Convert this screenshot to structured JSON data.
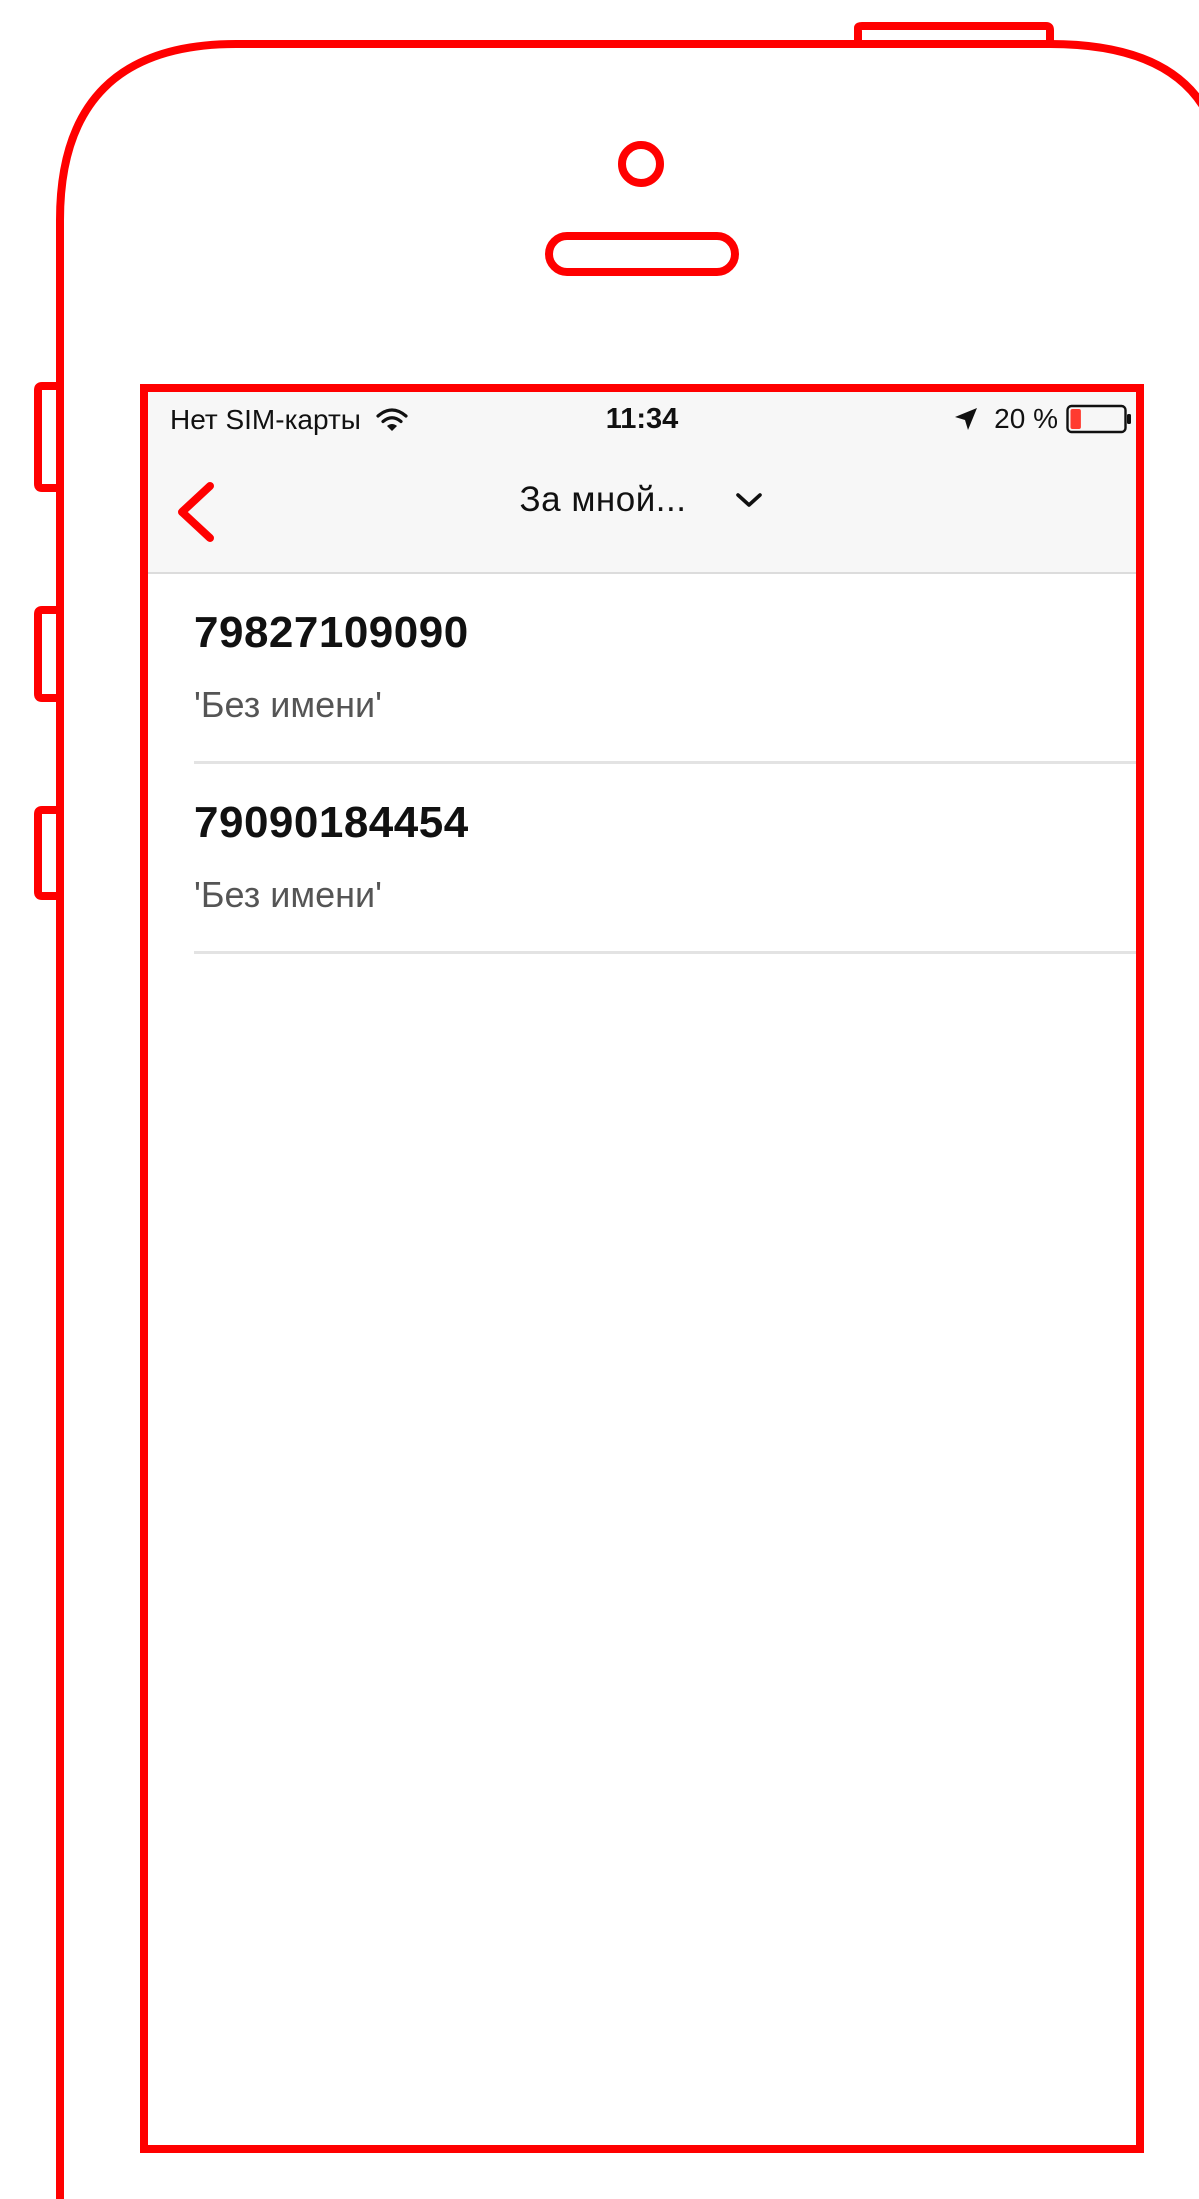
{
  "status_bar": {
    "carrier": "Нет SIM-карты",
    "time": "11:34",
    "battery": "20 %",
    "battery_level": 0.2,
    "icons": [
      "wifi-icon",
      "location-arrow-icon",
      "battery-icon"
    ]
  },
  "nav_bar": {
    "title": "За мной...",
    "back_icon": "chevron-left-icon",
    "title_dropdown_icon": "chevron-down-icon"
  },
  "list": {
    "items": [
      {
        "number": "79827109090",
        "name": "'Без имени'"
      },
      {
        "number": "79090184454",
        "name": "'Без имени'"
      }
    ]
  },
  "colors": {
    "accent": "#ff0000",
    "bar_background": "#f7f7f7",
    "divider": "#e3e3e3"
  }
}
